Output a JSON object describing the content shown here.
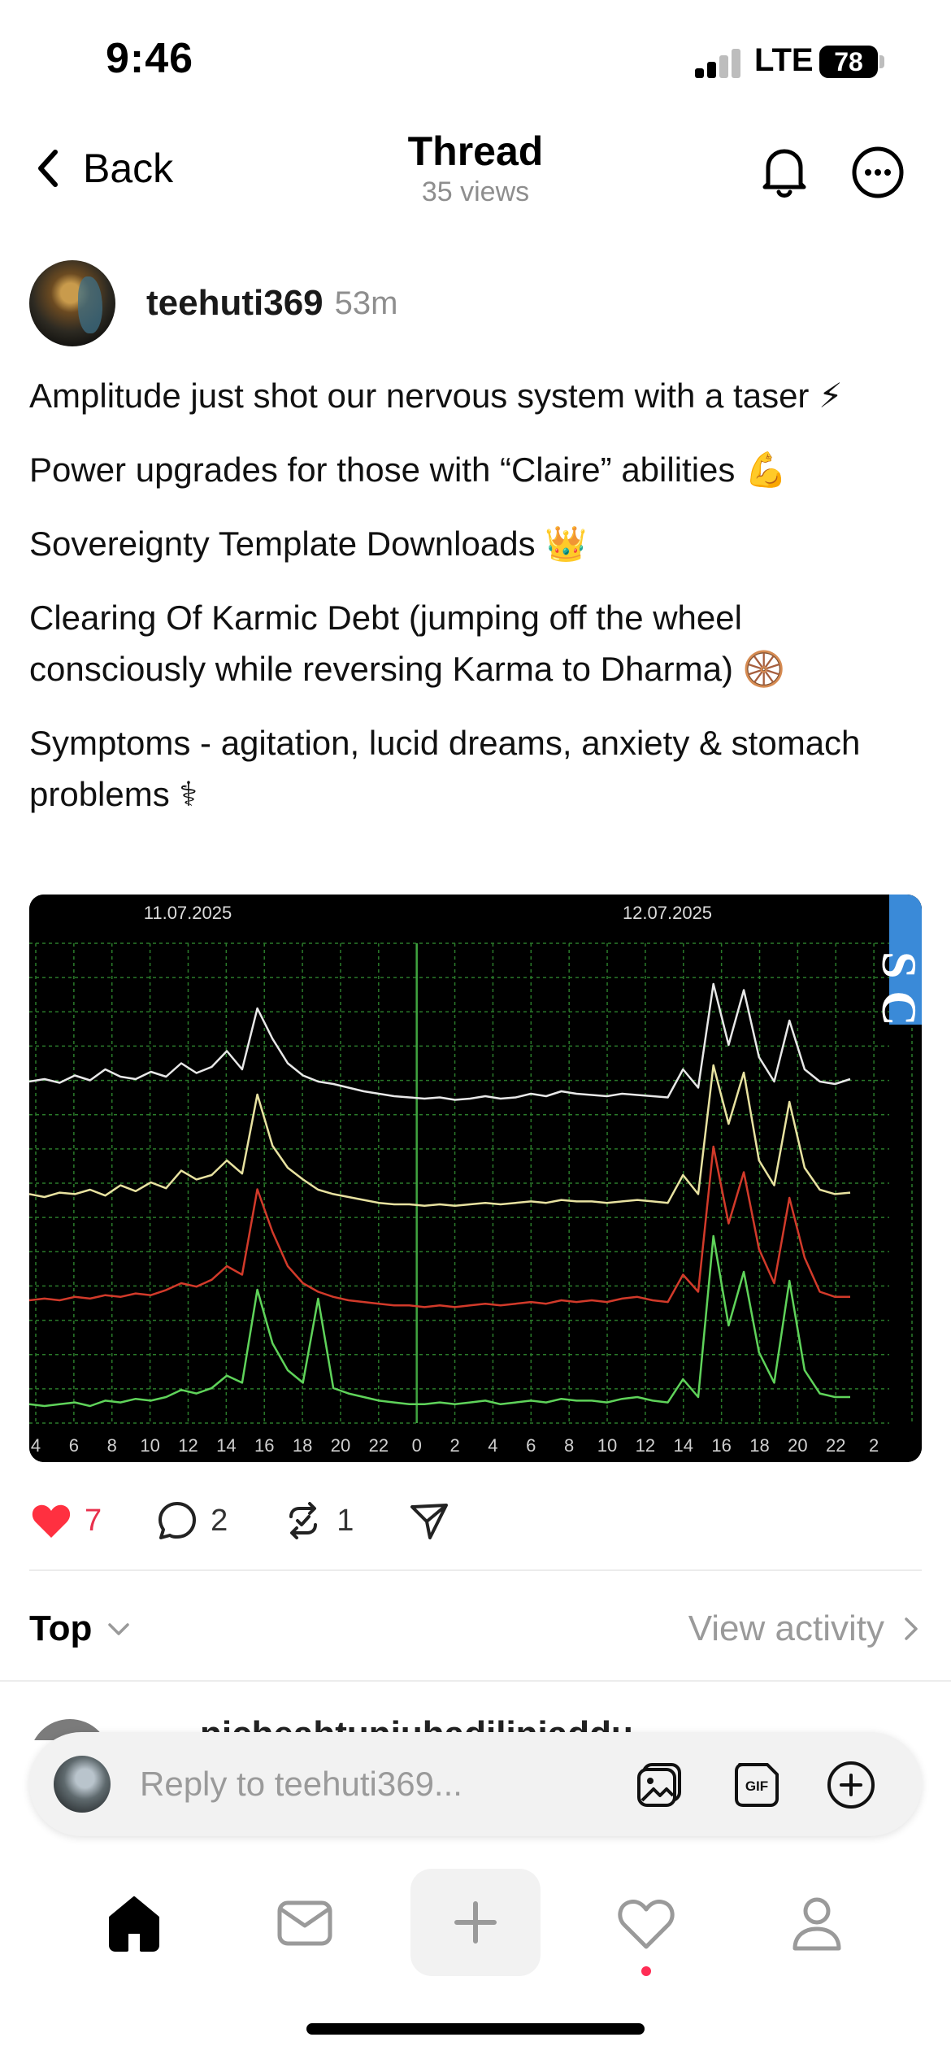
{
  "status": {
    "time": "9:46",
    "network": "LTE",
    "battery": "78"
  },
  "header": {
    "back_label": "Back",
    "title": "Thread",
    "views": "35 views"
  },
  "post": {
    "username": "teehuti369",
    "time_ago": "53m",
    "lines": [
      "Amplitude just shot our nervous system with a taser ⚡",
      "Power upgrades for those with “Claire” abilities 💪",
      "Sovereignty Template Downloads 👑",
      "Clearing Of Karmic Debt (jumping off the wheel consciously while reversing Karma to Dharma) 🛞",
      "Symptoms - agitation, lucid dreams, anxiety & stomach problems ⚕"
    ]
  },
  "chart_data": {
    "type": "line",
    "title": "",
    "date_labels": [
      "11.07.2025",
      "12.07.2025"
    ],
    "x_ticks": [
      "4",
      "6",
      "8",
      "10",
      "12",
      "14",
      "16",
      "18",
      "20",
      "22",
      "0",
      "2",
      "4",
      "6",
      "8",
      "10",
      "12",
      "14",
      "16",
      "18",
      "20",
      "22",
      "2"
    ],
    "watermark": "S C",
    "grid": true,
    "colors": {
      "white": "#e8e8e8",
      "yellow": "#e8e2a0",
      "red": "#d23a2a",
      "green": "#5fd35a",
      "grid": "#2a7a2a"
    },
    "series": [
      {
        "color": "#e8e8e8",
        "values": [
          0.2,
          0.22,
          0.19,
          0.25,
          0.21,
          0.3,
          0.24,
          0.22,
          0.28,
          0.24,
          0.35,
          0.27,
          0.32,
          0.45,
          0.3,
          0.8,
          0.55,
          0.35,
          0.25,
          0.2,
          0.18,
          0.15,
          0.12,
          0.1,
          0.08,
          0.07,
          0.06,
          0.07,
          0.05,
          0.06,
          0.08,
          0.06,
          0.07,
          0.1,
          0.08,
          0.12,
          0.1,
          0.09,
          0.08,
          0.1,
          0.09,
          0.08,
          0.07,
          0.3,
          0.15,
          1.0,
          0.5,
          0.95,
          0.4,
          0.2,
          0.7,
          0.3,
          0.2,
          0.18,
          0.22
        ]
      },
      {
        "color": "#e8e2a0",
        "values": [
          0.12,
          0.1,
          0.13,
          0.12,
          0.15,
          0.11,
          0.18,
          0.14,
          0.2,
          0.16,
          0.28,
          0.22,
          0.25,
          0.35,
          0.26,
          0.8,
          0.45,
          0.3,
          0.22,
          0.15,
          0.12,
          0.1,
          0.08,
          0.06,
          0.05,
          0.05,
          0.04,
          0.05,
          0.04,
          0.05,
          0.06,
          0.05,
          0.06,
          0.07,
          0.06,
          0.08,
          0.07,
          0.07,
          0.06,
          0.07,
          0.08,
          0.07,
          0.06,
          0.25,
          0.12,
          1.0,
          0.6,
          0.95,
          0.35,
          0.18,
          0.75,
          0.3,
          0.15,
          0.12,
          0.13
        ]
      },
      {
        "color": "#d23a2a",
        "values": [
          0.1,
          0.11,
          0.1,
          0.12,
          0.11,
          0.13,
          0.12,
          0.14,
          0.13,
          0.16,
          0.2,
          0.18,
          0.22,
          0.3,
          0.25,
          0.75,
          0.5,
          0.3,
          0.2,
          0.15,
          0.12,
          0.1,
          0.09,
          0.08,
          0.07,
          0.07,
          0.06,
          0.07,
          0.06,
          0.07,
          0.08,
          0.07,
          0.08,
          0.09,
          0.08,
          0.1,
          0.09,
          0.1,
          0.09,
          0.11,
          0.12,
          0.1,
          0.09,
          0.25,
          0.15,
          1.0,
          0.55,
          0.85,
          0.4,
          0.2,
          0.7,
          0.35,
          0.15,
          0.12,
          0.12
        ]
      },
      {
        "color": "#5fd35a",
        "values": [
          0.06,
          0.05,
          0.06,
          0.07,
          0.05,
          0.08,
          0.07,
          0.09,
          0.08,
          0.1,
          0.14,
          0.12,
          0.15,
          0.22,
          0.18,
          0.7,
          0.4,
          0.25,
          0.18,
          0.65,
          0.15,
          0.12,
          0.1,
          0.08,
          0.07,
          0.06,
          0.06,
          0.07,
          0.06,
          0.07,
          0.08,
          0.06,
          0.07,
          0.08,
          0.07,
          0.09,
          0.08,
          0.08,
          0.07,
          0.09,
          0.1,
          0.08,
          0.07,
          0.2,
          0.1,
          1.0,
          0.5,
          0.8,
          0.35,
          0.18,
          0.75,
          0.25,
          0.12,
          0.1,
          0.1
        ]
      }
    ]
  },
  "actions": {
    "likes": "7",
    "replies": "2",
    "reposts": "1"
  },
  "sort": {
    "label": "Top",
    "activity_label": "View activity"
  },
  "peek": {
    "name": "nicheahtunjuhadiliniaddu"
  },
  "reply": {
    "placeholder": "Reply to teehuti369..."
  }
}
